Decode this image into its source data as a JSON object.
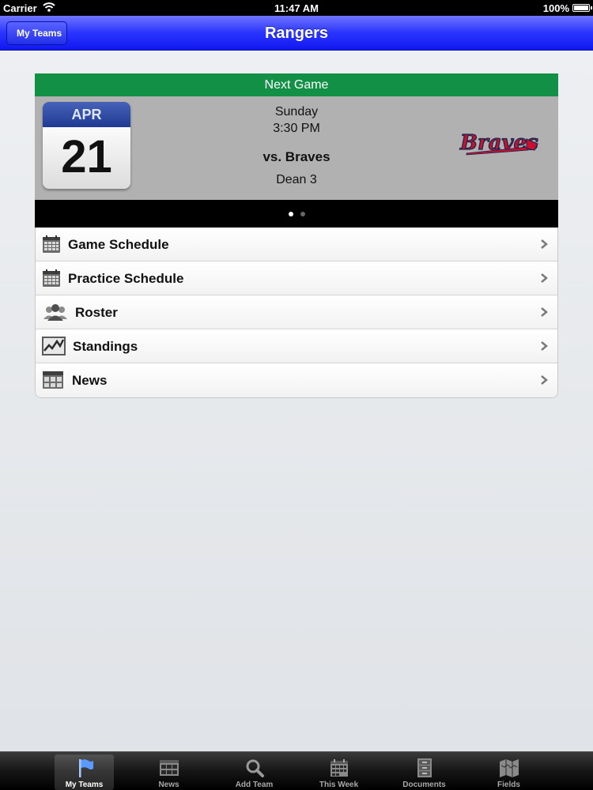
{
  "status_bar": {
    "carrier": "Carrier",
    "time": "11:47 AM",
    "battery": "100%"
  },
  "nav": {
    "title": "Rangers",
    "back_label": "My Teams"
  },
  "next_game": {
    "header": "Next Game",
    "month": "APR",
    "day": "21",
    "weekday": "Sunday",
    "time": "3:30 PM",
    "opponent": "vs. Braves",
    "field": "Dean 3",
    "opponent_logo_text": "Braves",
    "page_count": 2,
    "current_page": 1
  },
  "menu": {
    "items": [
      {
        "label": "Game Schedule",
        "icon": "calendar-icon"
      },
      {
        "label": "Practice Schedule",
        "icon": "calendar-icon"
      },
      {
        "label": "Roster",
        "icon": "people-icon"
      },
      {
        "label": "Standings",
        "icon": "chart-icon"
      },
      {
        "label": "News",
        "icon": "newspaper-icon"
      }
    ]
  },
  "tabs": [
    {
      "label": "My Teams",
      "icon": "flag-icon",
      "active": true
    },
    {
      "label": "News",
      "icon": "newspaper-icon",
      "active": false
    },
    {
      "label": "Add Team",
      "icon": "search-icon",
      "active": false
    },
    {
      "label": "This Week",
      "icon": "calendar-icon",
      "active": false
    },
    {
      "label": "Documents",
      "icon": "cabinet-icon",
      "active": false
    },
    {
      "label": "Fields",
      "icon": "map-icon",
      "active": false
    }
  ],
  "colors": {
    "nav_blue": "#2a34ff",
    "header_green": "#129146",
    "calendar_blue": "#1f3a92",
    "braves_red": "#c8102e",
    "braves_navy": "#13274f"
  }
}
